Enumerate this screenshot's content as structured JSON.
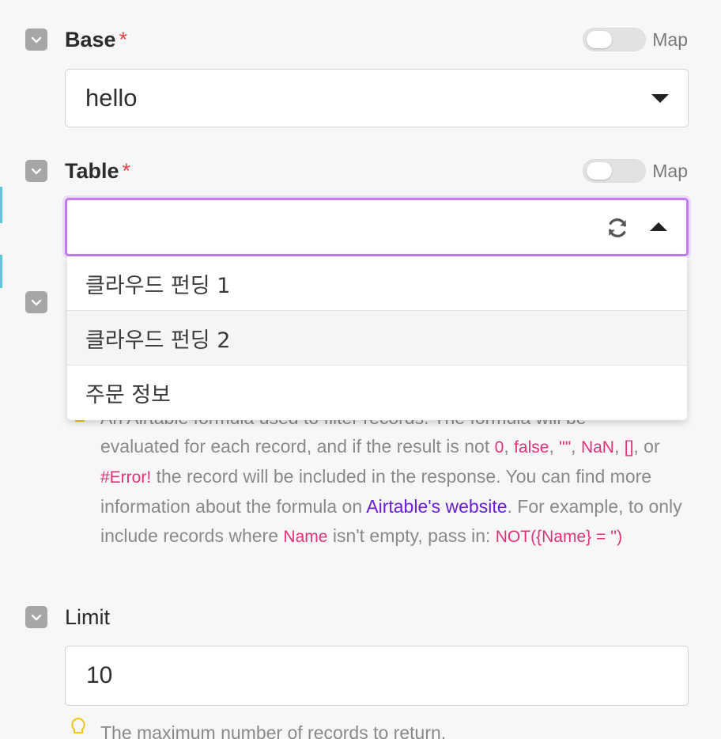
{
  "fields": {
    "base": {
      "label": "Base",
      "required_mark": "*",
      "map_label": "Map",
      "value": "hello"
    },
    "table": {
      "label": "Table",
      "required_mark": "*",
      "map_label": "Map",
      "value": "",
      "options": [
        "클라우드 펀딩 1",
        "클라우드 펀딩 2",
        "주문 정보"
      ]
    },
    "filter": {
      "help_line1_hidden": "An Airtable formula used to filter records. The formula will be",
      "help_prefix": "evaluated for each record, and if the result is not ",
      "code_zero": "0",
      "sep1": ", ",
      "code_false": "false",
      "sep2": ", ",
      "code_empty": "\"\"",
      "sep3": ", ",
      "code_nan": "NaN",
      "sep4": ",",
      "code_array": "[]",
      "sep5": ", or ",
      "code_error": "#Error!",
      "help_mid": " the record will be included in the response. You can find more information about the formula on ",
      "link_text": "Airtable's website",
      "help_after_link": ". For example, to only include records where ",
      "code_name": "Name",
      "help_after_name": " isn't empty, pass in: ",
      "code_example": "NOT({Name} = '')"
    },
    "limit": {
      "label": "Limit",
      "value": "10",
      "help": "The maximum number of records to return."
    }
  },
  "colors": {
    "required": "#e5484d",
    "focus_border": "#c17bf0",
    "code": "#e0327a",
    "link": "#6a1fd1",
    "checkbox": "#a6a6a6"
  },
  "icons": [
    "checkbox-collapse-icon",
    "chevron-down-icon",
    "chevron-up-icon",
    "refresh-icon",
    "lightbulb-icon"
  ]
}
